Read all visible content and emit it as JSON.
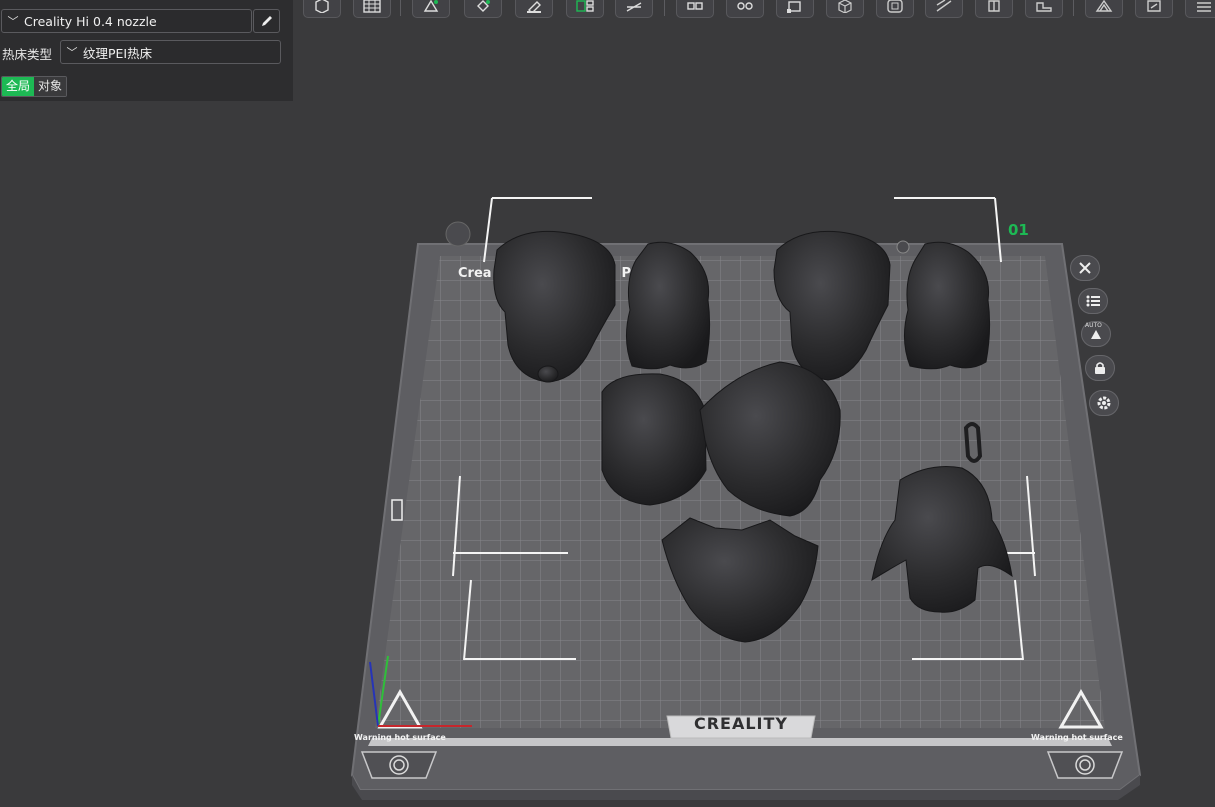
{
  "panel": {
    "printer": "Creality Hi 0.4 nozzle",
    "bed_type_label": "热床类型",
    "bed_type_value": "纹理PEI热床",
    "scope_global": "全局",
    "scope_object": "对象"
  },
  "toolbar": {
    "icons": [
      "cube-icon",
      "grid-icon",
      "auto-orient-icon",
      "rotate-icon",
      "paint-icon",
      "arrange-icon",
      "cut-icon",
      "split-objects-icon",
      "split-parts-icon",
      "scale-icon",
      "view-cube-icon",
      "hollow-icon",
      "support-paint-icon",
      "seam-icon",
      "measure-icon",
      "assembly-icon",
      "text-icon",
      "more-icon"
    ]
  },
  "plate": {
    "index": "01",
    "title": "Crea",
    "title_tail": "P",
    "brand": "CREALITY",
    "warning_left": "Warning hot surface",
    "warning_right": "Warning hot surface",
    "side_buttons": [
      "close-icon",
      "list-icon",
      "auto-orient-icon",
      "lock-icon",
      "settings-icon"
    ],
    "auto_label": "AUTO"
  },
  "colors": {
    "accent": "#1db954",
    "background": "#3a3a3c",
    "plate": "#5e5e62",
    "model": "#2c2c2e"
  }
}
